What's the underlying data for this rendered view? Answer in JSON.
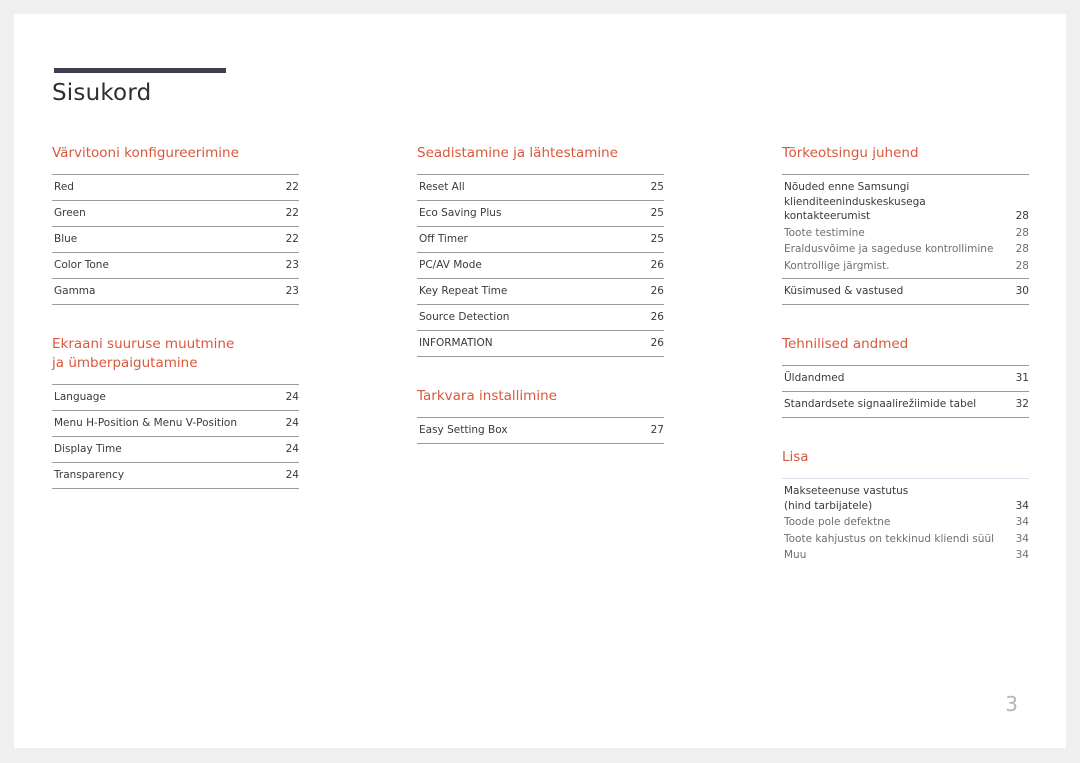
{
  "document": {
    "title": "Sisukord",
    "folio": "3",
    "accent_color": "#d9583c",
    "rule_color": "#9b9b9b",
    "title_bar_color": "#3f3d4f",
    "page_background": "#ffffff",
    "canvas_background": "#efefef"
  },
  "columns": [
    {
      "sections": [
        {
          "heading": "Värvitooni konfigureerimine",
          "entries": [
            {
              "label": "Red",
              "page": "22",
              "style": "normal"
            },
            {
              "label": "Green",
              "page": "22",
              "style": "normal"
            },
            {
              "label": "Blue",
              "page": "22",
              "style": "normal"
            },
            {
              "label": "Color Tone",
              "page": "23",
              "style": "normal"
            },
            {
              "label": "Gamma",
              "page": "23",
              "style": "normal"
            }
          ]
        },
        {
          "heading": "Ekraani suuruse muutmine\nja ümberpaigutamine",
          "entries": [
            {
              "label": "Language",
              "page": "24",
              "style": "normal"
            },
            {
              "label": "Menu H-Position & Menu V-Position",
              "page": "24",
              "style": "normal"
            },
            {
              "label": "Display Time",
              "page": "24",
              "style": "normal"
            },
            {
              "label": "Transparency",
              "page": "24",
              "style": "normal"
            }
          ]
        }
      ]
    },
    {
      "sections": [
        {
          "heading": "Seadistamine ja lähtestamine",
          "entries": [
            {
              "label": "Reset All",
              "page": "25",
              "style": "normal"
            },
            {
              "label": "Eco Saving Plus",
              "page": "25",
              "style": "normal"
            },
            {
              "label": "Off Timer",
              "page": "25",
              "style": "normal"
            },
            {
              "label": "PC/AV Mode",
              "page": "26",
              "style": "normal"
            },
            {
              "label": "Key Repeat Time",
              "page": "26",
              "style": "normal"
            },
            {
              "label": "Source Detection",
              "page": "26",
              "style": "normal"
            },
            {
              "label": "INFORMATION",
              "page": "26",
              "style": "normal"
            }
          ]
        },
        {
          "heading": "Tarkvara installimine",
          "entries": [
            {
              "label": "Easy Setting Box",
              "page": "27",
              "style": "normal"
            }
          ]
        }
      ]
    },
    {
      "sections": [
        {
          "heading": "Tõrkeotsingu juhend",
          "entries": [
            {
              "label": "Nõuded enne Samsungi klienditeeninduskeskusega\nkontakteerumist",
              "page": "28",
              "style": "tight"
            },
            {
              "label": "Toote testimine",
              "page": "28",
              "style": "tight-sub"
            },
            {
              "label": "Eraldusvõime ja sageduse kontrollimine",
              "page": "28",
              "style": "tight-sub"
            },
            {
              "label": "Kontrollige järgmist.",
              "page": "28",
              "style": "tight-sub-last"
            },
            {
              "label": "Küsimused & vastused",
              "page": "30",
              "style": "normal"
            }
          ]
        },
        {
          "heading": "Tehnilised andmed",
          "entries": [
            {
              "label": "Üldandmed",
              "page": "31",
              "style": "normal"
            },
            {
              "label": "Standardsete signaalirežiimide tabel",
              "page": "32",
              "style": "normal"
            }
          ]
        },
        {
          "heading": "Lisa",
          "rule_tint": true,
          "entries": [
            {
              "label": "Makseteenuse vastutus\n(hind tarbijatele)",
              "page": "34",
              "style": "tight"
            },
            {
              "label": "Toode pole defektne",
              "page": "34",
              "style": "tight-sub"
            },
            {
              "label": "Toote kahjustus on tekkinud kliendi süül",
              "page": "34",
              "style": "tight-sub"
            },
            {
              "label": "Muu",
              "page": "34",
              "style": "tight-sub-open"
            }
          ]
        }
      ]
    }
  ]
}
